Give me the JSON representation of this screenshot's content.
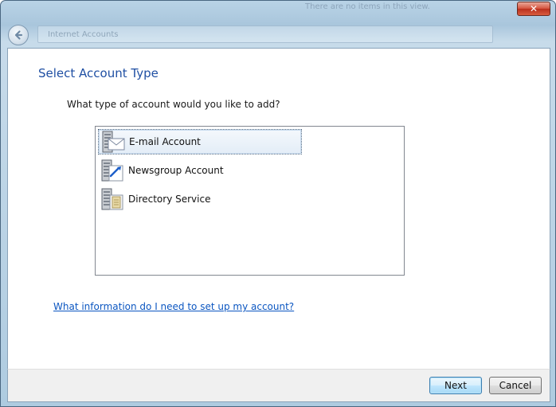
{
  "window": {
    "ghost_title": "There are no items in this view.",
    "close_glyph": "✕",
    "address_text": "Internet Accounts"
  },
  "page": {
    "title": "Select Account Type",
    "question": "What type of account would you like to add?"
  },
  "account_types": [
    {
      "label": "E-mail Account",
      "icon": "email-server-icon",
      "selected": true
    },
    {
      "label": "Newsgroup Account",
      "icon": "newsgroup-server-icon",
      "selected": false
    },
    {
      "label": "Directory Service",
      "icon": "directory-server-icon",
      "selected": false
    }
  ],
  "help_link": "What information do I need to set up my account?",
  "buttons": {
    "next": "Next",
    "cancel": "Cancel"
  },
  "colors": {
    "title_blue": "#1f4fa3",
    "link_blue": "#0b56c1",
    "selection_bg": "#e3edf7"
  }
}
